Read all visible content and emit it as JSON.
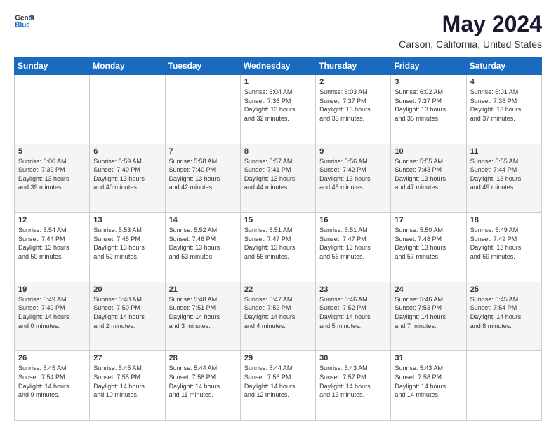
{
  "header": {
    "logo_line1": "General",
    "logo_line2": "Blue",
    "month_title": "May 2024",
    "location": "Carson, California, United States"
  },
  "days_of_week": [
    "Sunday",
    "Monday",
    "Tuesday",
    "Wednesday",
    "Thursday",
    "Friday",
    "Saturday"
  ],
  "weeks": [
    [
      {
        "day": "",
        "content": ""
      },
      {
        "day": "",
        "content": ""
      },
      {
        "day": "",
        "content": ""
      },
      {
        "day": "1",
        "content": "Sunrise: 6:04 AM\nSunset: 7:36 PM\nDaylight: 13 hours\nand 32 minutes."
      },
      {
        "day": "2",
        "content": "Sunrise: 6:03 AM\nSunset: 7:37 PM\nDaylight: 13 hours\nand 33 minutes."
      },
      {
        "day": "3",
        "content": "Sunrise: 6:02 AM\nSunset: 7:37 PM\nDaylight: 13 hours\nand 35 minutes."
      },
      {
        "day": "4",
        "content": "Sunrise: 6:01 AM\nSunset: 7:38 PM\nDaylight: 13 hours\nand 37 minutes."
      }
    ],
    [
      {
        "day": "5",
        "content": "Sunrise: 6:00 AM\nSunset: 7:39 PM\nDaylight: 13 hours\nand 39 minutes."
      },
      {
        "day": "6",
        "content": "Sunrise: 5:59 AM\nSunset: 7:40 PM\nDaylight: 13 hours\nand 40 minutes."
      },
      {
        "day": "7",
        "content": "Sunrise: 5:58 AM\nSunset: 7:40 PM\nDaylight: 13 hours\nand 42 minutes."
      },
      {
        "day": "8",
        "content": "Sunrise: 5:57 AM\nSunset: 7:41 PM\nDaylight: 13 hours\nand 44 minutes."
      },
      {
        "day": "9",
        "content": "Sunrise: 5:56 AM\nSunset: 7:42 PM\nDaylight: 13 hours\nand 45 minutes."
      },
      {
        "day": "10",
        "content": "Sunrise: 5:55 AM\nSunset: 7:43 PM\nDaylight: 13 hours\nand 47 minutes."
      },
      {
        "day": "11",
        "content": "Sunrise: 5:55 AM\nSunset: 7:44 PM\nDaylight: 13 hours\nand 49 minutes."
      }
    ],
    [
      {
        "day": "12",
        "content": "Sunrise: 5:54 AM\nSunset: 7:44 PM\nDaylight: 13 hours\nand 50 minutes."
      },
      {
        "day": "13",
        "content": "Sunrise: 5:53 AM\nSunset: 7:45 PM\nDaylight: 13 hours\nand 52 minutes."
      },
      {
        "day": "14",
        "content": "Sunrise: 5:52 AM\nSunset: 7:46 PM\nDaylight: 13 hours\nand 53 minutes."
      },
      {
        "day": "15",
        "content": "Sunrise: 5:51 AM\nSunset: 7:47 PM\nDaylight: 13 hours\nand 55 minutes."
      },
      {
        "day": "16",
        "content": "Sunrise: 5:51 AM\nSunset: 7:47 PM\nDaylight: 13 hours\nand 56 minutes."
      },
      {
        "day": "17",
        "content": "Sunrise: 5:50 AM\nSunset: 7:48 PM\nDaylight: 13 hours\nand 57 minutes."
      },
      {
        "day": "18",
        "content": "Sunrise: 5:49 AM\nSunset: 7:49 PM\nDaylight: 13 hours\nand 59 minutes."
      }
    ],
    [
      {
        "day": "19",
        "content": "Sunrise: 5:49 AM\nSunset: 7:49 PM\nDaylight: 14 hours\nand 0 minutes."
      },
      {
        "day": "20",
        "content": "Sunrise: 5:48 AM\nSunset: 7:50 PM\nDaylight: 14 hours\nand 2 minutes."
      },
      {
        "day": "21",
        "content": "Sunrise: 5:48 AM\nSunset: 7:51 PM\nDaylight: 14 hours\nand 3 minutes."
      },
      {
        "day": "22",
        "content": "Sunrise: 5:47 AM\nSunset: 7:52 PM\nDaylight: 14 hours\nand 4 minutes."
      },
      {
        "day": "23",
        "content": "Sunrise: 5:46 AM\nSunset: 7:52 PM\nDaylight: 14 hours\nand 5 minutes."
      },
      {
        "day": "24",
        "content": "Sunrise: 5:46 AM\nSunset: 7:53 PM\nDaylight: 14 hours\nand 7 minutes."
      },
      {
        "day": "25",
        "content": "Sunrise: 5:45 AM\nSunset: 7:54 PM\nDaylight: 14 hours\nand 8 minutes."
      }
    ],
    [
      {
        "day": "26",
        "content": "Sunrise: 5:45 AM\nSunset: 7:54 PM\nDaylight: 14 hours\nand 9 minutes."
      },
      {
        "day": "27",
        "content": "Sunrise: 5:45 AM\nSunset: 7:55 PM\nDaylight: 14 hours\nand 10 minutes."
      },
      {
        "day": "28",
        "content": "Sunrise: 5:44 AM\nSunset: 7:56 PM\nDaylight: 14 hours\nand 11 minutes."
      },
      {
        "day": "29",
        "content": "Sunrise: 5:44 AM\nSunset: 7:56 PM\nDaylight: 14 hours\nand 12 minutes."
      },
      {
        "day": "30",
        "content": "Sunrise: 5:43 AM\nSunset: 7:57 PM\nDaylight: 14 hours\nand 13 minutes."
      },
      {
        "day": "31",
        "content": "Sunrise: 5:43 AM\nSunset: 7:58 PM\nDaylight: 14 hours\nand 14 minutes."
      },
      {
        "day": "",
        "content": ""
      }
    ]
  ]
}
